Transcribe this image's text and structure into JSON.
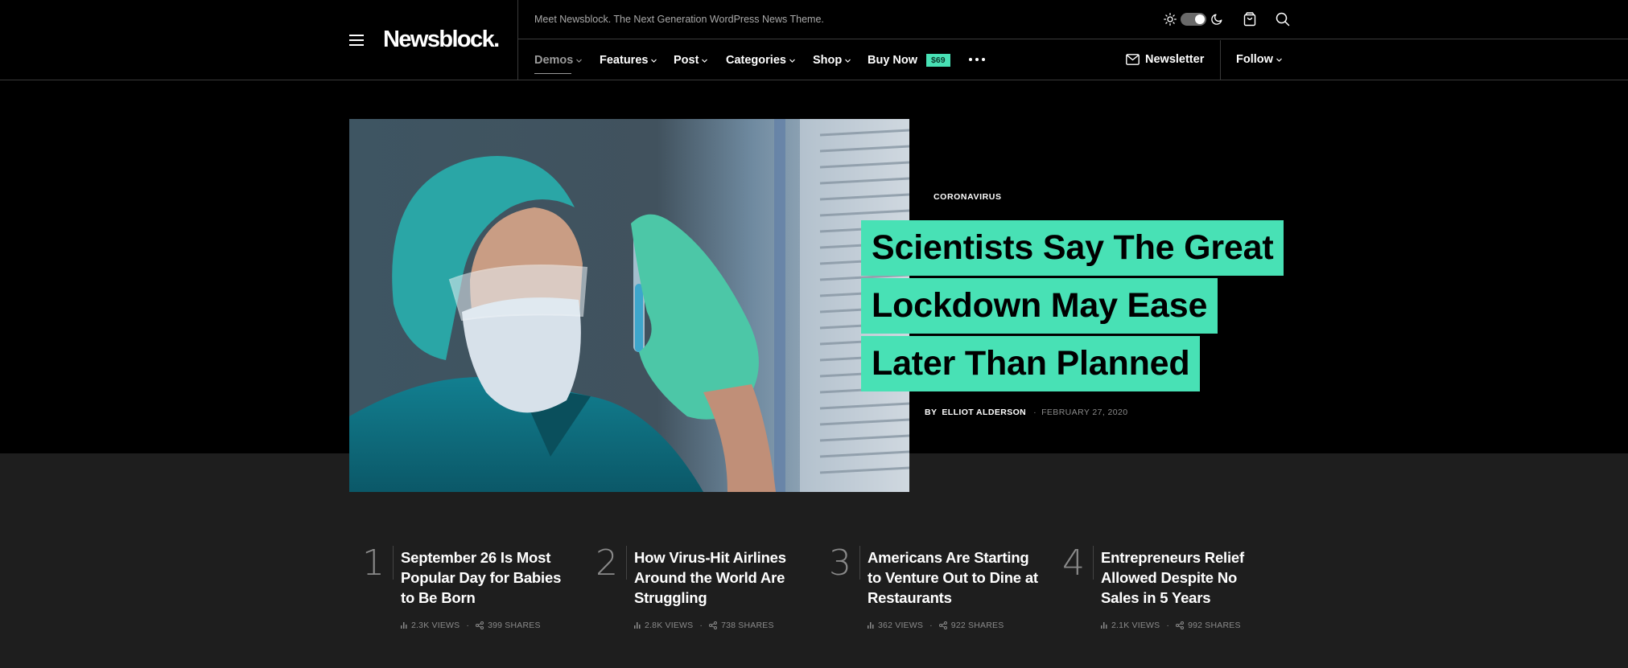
{
  "header": {
    "logo": "Newsblock.",
    "tagline": "Meet Newsblock. The Next Generation WordPress News Theme.",
    "nav": [
      {
        "label": "Demos",
        "has_dropdown": true,
        "active": true
      },
      {
        "label": "Features",
        "has_dropdown": true
      },
      {
        "label": "Post",
        "has_dropdown": true
      },
      {
        "label": "Categories",
        "has_dropdown": true
      },
      {
        "label": "Shop",
        "has_dropdown": true
      },
      {
        "label": "Buy Now",
        "badge": "$69"
      }
    ],
    "newsletter_label": "Newsletter",
    "follow_label": "Follow",
    "icons": [
      "menu-icon",
      "sun-icon",
      "theme-toggle",
      "moon-icon",
      "cart-icon",
      "search-icon",
      "more-icon",
      "mail-icon"
    ],
    "dark_mode": true
  },
  "hero": {
    "category": "CORONAVIRUS",
    "headline_lines": [
      "Scientists Say The Great",
      "Lockdown May Ease",
      "Later Than Planned"
    ],
    "by_label": "BY",
    "author": "ELLIOT ALDERSON",
    "date": "FEBRUARY 27, 2020",
    "image_alt": "Scientist in mask and goggles holding a test tube"
  },
  "trending": [
    {
      "rank": "1",
      "title": "September 26 Is Most Popular Day for Babies to Be Born",
      "views": "2.3K VIEWS",
      "shares": "399 SHARES"
    },
    {
      "rank": "2",
      "title": "How Virus-Hit Airlines Around the World Are Struggling",
      "views": "2.8K VIEWS",
      "shares": "738 SHARES"
    },
    {
      "rank": "3",
      "title": "Americans Are Starting to Venture Out to Dine at Restaurants",
      "views": "362 VIEWS",
      "shares": "922 SHARES"
    },
    {
      "rank": "4",
      "title": "Entrepreneurs Relief Allowed Despite No Sales in 5 Years",
      "views": "2.1K VIEWS",
      "shares": "992 SHARES"
    }
  ],
  "colors": {
    "accent": "#48e1b5",
    "background": "#000000",
    "section_background": "#1e1e1e"
  }
}
